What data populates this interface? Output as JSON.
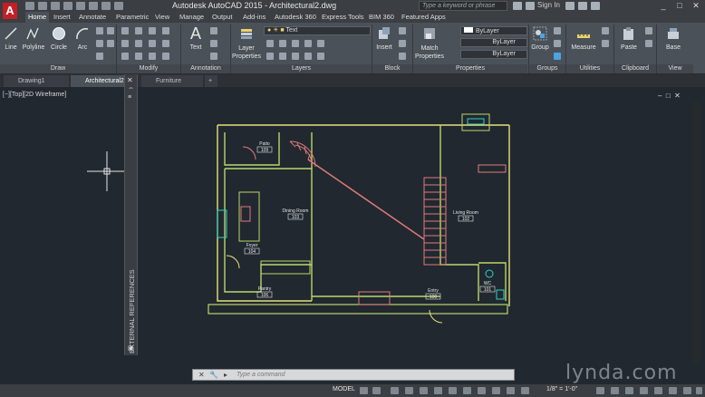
{
  "window": {
    "title": "Autodesk AutoCAD 2015 - Architectural2.dwg",
    "search_placeholder": "Type a keyword or phrase",
    "signin": "Sign In",
    "controls": [
      "_",
      "□",
      "✕"
    ]
  },
  "ribbon_tabs": [
    "Home",
    "Insert",
    "Annotate",
    "Parametric",
    "View",
    "Manage",
    "Output",
    "Add-ins",
    "Autodesk 360",
    "Express Tools",
    "BIM 360",
    "Featured Apps"
  ],
  "ribbon": {
    "draw": {
      "title": "Draw",
      "tools": [
        "Line",
        "Polyline",
        "Circle",
        "Arc"
      ]
    },
    "modify": {
      "title": "Modify"
    },
    "annotation": {
      "title": "Annotation",
      "tool": "Text"
    },
    "layers": {
      "title": "Layers",
      "layer_properties": "Layer Properties",
      "current_layer": "Text"
    },
    "block": {
      "title": "Block",
      "insert": "Insert"
    },
    "properties": {
      "title": "Properties",
      "match": "Match Properties",
      "color": "ByLayer",
      "linetype": "ByLayer",
      "lineweight": "ByLayer"
    },
    "groups": {
      "title": "Groups",
      "group": "Group"
    },
    "utilities": {
      "title": "Utilities",
      "measure": "Measure"
    },
    "clipboard": {
      "title": "Clipboard",
      "paste": "Paste"
    },
    "view": {
      "title": "View",
      "base": "Base"
    }
  },
  "file_tabs": [
    "Drawing1",
    "Architectural2",
    "Furniture"
  ],
  "viewport": {
    "label": "[−][Top][2D Wireframe]",
    "xref_palette": "EXTERNAL REFERENCES"
  },
  "rooms": [
    {
      "name": "Patio",
      "num": "109"
    },
    {
      "name": "Dining Room",
      "num": "103"
    },
    {
      "name": "Living Room",
      "num": "102"
    },
    {
      "name": "Foyer",
      "num": "104"
    },
    {
      "name": "Pantry",
      "num": "106"
    },
    {
      "name": "Entry",
      "num": "100"
    },
    {
      "name": "WC",
      "num": "101"
    }
  ],
  "command": {
    "placeholder": "Type a command"
  },
  "status": {
    "model": "MODEL",
    "scale": "1/8\" = 1'-0\""
  },
  "watermark": "lynda.com",
  "colors": {
    "wall_green": "#b9d76a",
    "wall_yellow": "#e6e07a",
    "stair_red": "#e07a7a",
    "cyan": "#2ad3c8",
    "background": "#212830",
    "ribbon": "#4b5158"
  }
}
